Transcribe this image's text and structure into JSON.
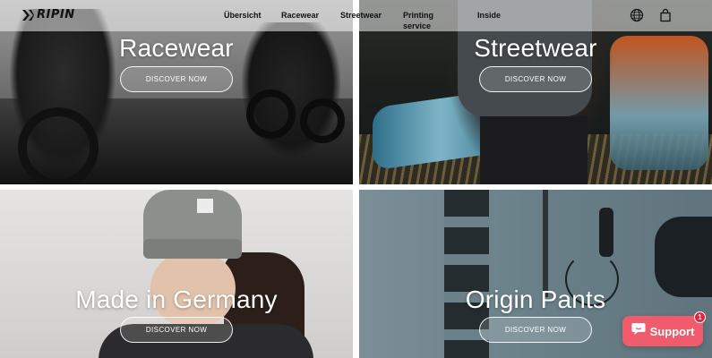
{
  "header": {
    "logo_text": "RIPIN",
    "nav": [
      {
        "label": "Übersicht"
      },
      {
        "label": "Racewear"
      },
      {
        "label": "Streetwear"
      },
      {
        "label": "Printing service"
      },
      {
        "label": "Inside"
      }
    ],
    "icons": [
      "globe-icon",
      "shopping-bag-icon"
    ]
  },
  "tiles": [
    {
      "title": "Racewear",
      "button": "DISCOVER NOW"
    },
    {
      "title": "Streetwear",
      "button": "DISCOVER NOW"
    },
    {
      "title": "Made in Germany",
      "button": "DISCOVER NOW"
    },
    {
      "title": "Origin Pants",
      "button": "DISCOVER NOW"
    }
  ],
  "support": {
    "label": "Support",
    "badge_count": "1",
    "icon": "chat-bubble-icon"
  },
  "colors": {
    "support_bg": "#f05c6b",
    "badge_bg": "#e0243a",
    "text": "#111111"
  }
}
